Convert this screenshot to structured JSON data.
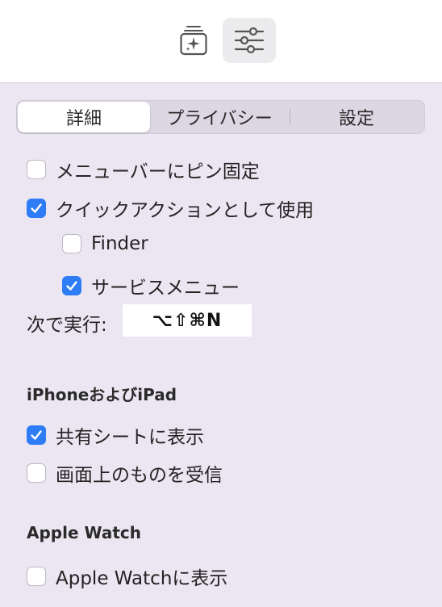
{
  "toolbar": {
    "buttons": [
      {
        "icon": "sparkle-stack-icon",
        "active": false
      },
      {
        "icon": "sliders-icon",
        "active": true
      }
    ]
  },
  "tabs": {
    "items": [
      {
        "label": "詳細",
        "selected": true
      },
      {
        "label": "プライバシー",
        "selected": false
      },
      {
        "label": "設定",
        "selected": false
      }
    ]
  },
  "general": {
    "pin_menubar": {
      "label": "メニューバーにピン固定",
      "checked": false
    },
    "quick_action": {
      "label": "クイックアクションとして使用",
      "checked": true
    },
    "finder": {
      "label": "Finder",
      "checked": false
    },
    "services_menu": {
      "label": "サービスメニュー",
      "checked": true
    },
    "shortcut_label": "次で実行:",
    "shortcut_value": "⌥⇧⌘N"
  },
  "iphone_ipad": {
    "title": "iPhoneおよびiPad",
    "share_sheet": {
      "label": "共有シートに表示",
      "checked": true
    },
    "receive_screen": {
      "label": "画面上のものを受信",
      "checked": false
    }
  },
  "apple_watch": {
    "title": "Apple Watch",
    "show_on_watch": {
      "label": "Apple Watchに表示",
      "checked": false
    }
  },
  "colors": {
    "accent": "#2e7cf6",
    "background": "#ebe6f1"
  }
}
